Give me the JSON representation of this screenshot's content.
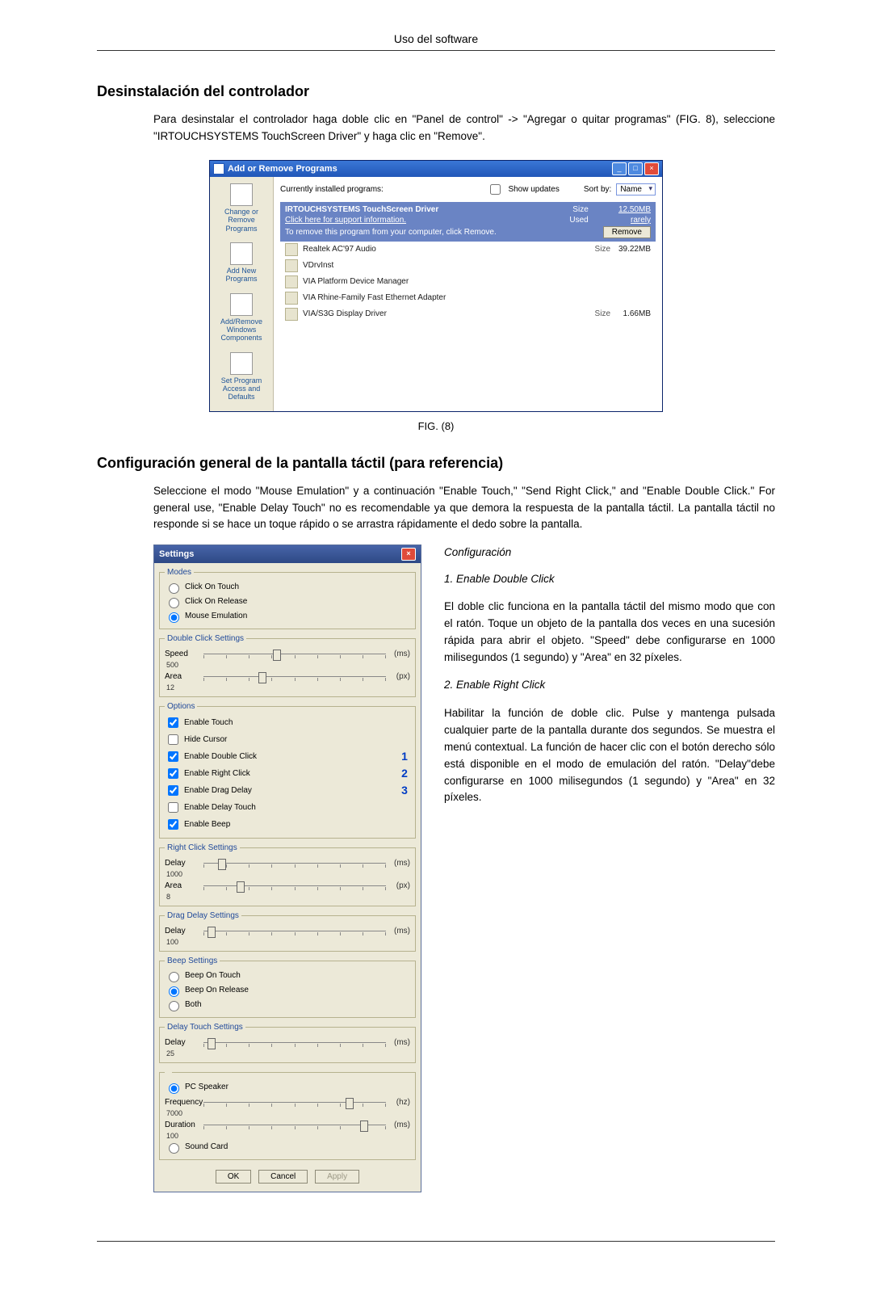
{
  "page_header": "Uso del software",
  "section1_title": "Desinstalación del controlador",
  "section1_body": "Para desinstalar el controlador haga doble clic en \"Panel de control\" -> \"Agregar o quitar programas\" (FIG. 8), seleccione \"IRTOUCHSYSTEMS TouchScreen Driver\" y haga clic en \"Remove\".",
  "fig8_caption": "FIG. (8)",
  "arp": {
    "title": "Add or Remove Programs",
    "current_label": "Currently installed programs:",
    "show_updates": "Show updates",
    "sort_label": "Sort by:",
    "sort_value": "Name",
    "remove_btn": "Remove",
    "side": [
      "Change or Remove Programs",
      "Add New Programs",
      "Add/Remove Windows Components",
      "Set Program Access and Defaults"
    ],
    "selected": {
      "name": "IRTOUCHSYSTEMS TouchScreen Driver",
      "support": "Click here for support information.",
      "remove_line": "To remove this program from your computer, click Remove.",
      "size_label": "Size",
      "size_value": "12.50MB",
      "used_label": "Used",
      "used_value": "rarely"
    },
    "programs": [
      {
        "name": "Realtek AC'97 Audio",
        "size_label": "Size",
        "size": "39.22MB"
      },
      {
        "name": "VDrvInst",
        "size_label": "",
        "size": ""
      },
      {
        "name": "VIA Platform Device Manager",
        "size_label": "",
        "size": ""
      },
      {
        "name": "VIA Rhine-Family Fast Ethernet Adapter",
        "size_label": "",
        "size": ""
      },
      {
        "name": "VIA/S3G Display Driver",
        "size_label": "Size",
        "size": "1.66MB"
      }
    ]
  },
  "section2_title": "Configuración general de la pantalla táctil (para referencia)",
  "section2_body": "Seleccione el modo \"Mouse Emulation\" y a continuación \"Enable Touch,\" \"Send Right Click,\" and \"Enable Double Click.\" For general use, \"Enable Delay Touch\" no es recomendable ya que demora la respuesta de la pantalla táctil. La pantalla táctil no responde si se hace un toque rápido o se arrastra rápidamente el dedo sobre la pantalla.",
  "settings": {
    "title": "Settings",
    "modes_legend": "Modes",
    "modes": {
      "click_on_touch": "Click On Touch",
      "click_on_release": "Click On Release",
      "mouse_emulation": "Mouse Emulation"
    },
    "options_legend": "Options",
    "options": {
      "enable_touch": "Enable Touch",
      "hide_cursor": "Hide Cursor",
      "enable_double_click": "Enable Double Click",
      "enable_right_click": "Enable Right Click",
      "enable_drag_delay": "Enable Drag Delay",
      "enable_delay_touch": "Enable Delay Touch",
      "enable_beep": "Enable Beep"
    },
    "badges": {
      "b1": "1",
      "b2": "2",
      "b3": "3"
    },
    "dcs_legend": "Double Click Settings",
    "dcs": {
      "speed_label": "Speed",
      "speed_val": "500",
      "speed_unit": "(ms)",
      "area_label": "Area",
      "area_val": "12",
      "area_unit": "(px)"
    },
    "rcs_legend": "Right Click Settings",
    "rcs": {
      "delay_label": "Delay",
      "delay_val": "1000",
      "delay_unit": "(ms)",
      "area_label": "Area",
      "area_val": "8",
      "area_unit": "(px)"
    },
    "beep_legend": "Beep Settings",
    "beep": {
      "on_touch": "Beep On Touch",
      "on_release": "Beep On Release",
      "both": "Both"
    },
    "spk": {
      "pc_speaker": "PC Speaker",
      "freq_label": "Frequency",
      "freq_val": "7000",
      "freq_unit": "(hz)",
      "dur_label": "Duration",
      "dur_val": "100",
      "dur_unit": "(ms)",
      "sound_card": "Sound Card"
    },
    "dds_legend": "Drag Delay Settings",
    "dds": {
      "delay_label": "Delay",
      "delay_val": "100",
      "delay_unit": "(ms)"
    },
    "dts_legend": "Delay Touch Settings",
    "dts": {
      "delay_label": "Delay",
      "delay_val": "25",
      "delay_unit": "(ms)"
    },
    "buttons": {
      "ok": "OK",
      "cancel": "Cancel",
      "apply": "Apply"
    }
  },
  "cfg": {
    "heading": "Configuración",
    "h1": "1. Enable Double Click",
    "p1": "El doble clic funciona en la pantalla táctil del mismo modo que con el ratón. Toque un objeto de la pantalla dos veces en una sucesión rápida para abrir el objeto. \"Speed\" debe configurarse en 1000 milisegundos (1 segundo) y \"Area\" en 32 píxeles.",
    "h2": "2. Enable Right Click",
    "p2": "Habilitar la función de doble clic. Pulse y mantenga pulsada cualquier parte de la pantalla durante dos segundos. Se muestra el menú contextual. La función de hacer clic con el botón derecho sólo está disponible en el modo de emulación del ratón. \"Delay\"debe configurarse en 1000 milisegundos (1 segundo) y \"Area\" en 32 píxeles."
  }
}
